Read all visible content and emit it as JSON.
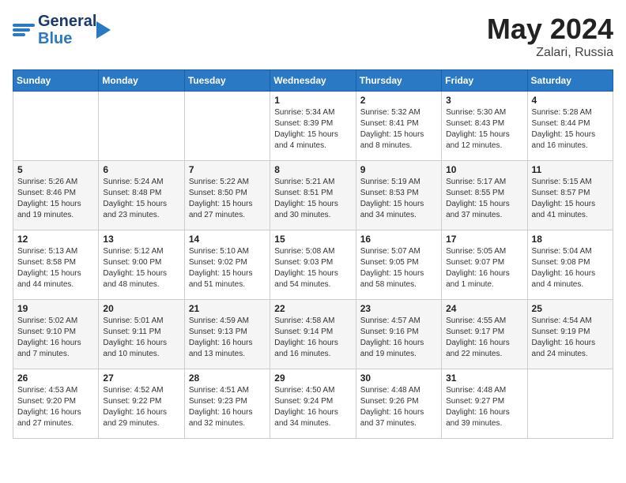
{
  "header": {
    "logo_line1": "General",
    "logo_line2": "Blue",
    "month": "May 2024",
    "location": "Zalari, Russia"
  },
  "days_of_week": [
    "Sunday",
    "Monday",
    "Tuesday",
    "Wednesday",
    "Thursday",
    "Friday",
    "Saturday"
  ],
  "weeks": [
    [
      {
        "day": "",
        "info": ""
      },
      {
        "day": "",
        "info": ""
      },
      {
        "day": "",
        "info": ""
      },
      {
        "day": "1",
        "info": "Sunrise: 5:34 AM\nSunset: 8:39 PM\nDaylight: 15 hours\nand 4 minutes."
      },
      {
        "day": "2",
        "info": "Sunrise: 5:32 AM\nSunset: 8:41 PM\nDaylight: 15 hours\nand 8 minutes."
      },
      {
        "day": "3",
        "info": "Sunrise: 5:30 AM\nSunset: 8:43 PM\nDaylight: 15 hours\nand 12 minutes."
      },
      {
        "day": "4",
        "info": "Sunrise: 5:28 AM\nSunset: 8:44 PM\nDaylight: 15 hours\nand 16 minutes."
      }
    ],
    [
      {
        "day": "5",
        "info": "Sunrise: 5:26 AM\nSunset: 8:46 PM\nDaylight: 15 hours\nand 19 minutes."
      },
      {
        "day": "6",
        "info": "Sunrise: 5:24 AM\nSunset: 8:48 PM\nDaylight: 15 hours\nand 23 minutes."
      },
      {
        "day": "7",
        "info": "Sunrise: 5:22 AM\nSunset: 8:50 PM\nDaylight: 15 hours\nand 27 minutes."
      },
      {
        "day": "8",
        "info": "Sunrise: 5:21 AM\nSunset: 8:51 PM\nDaylight: 15 hours\nand 30 minutes."
      },
      {
        "day": "9",
        "info": "Sunrise: 5:19 AM\nSunset: 8:53 PM\nDaylight: 15 hours\nand 34 minutes."
      },
      {
        "day": "10",
        "info": "Sunrise: 5:17 AM\nSunset: 8:55 PM\nDaylight: 15 hours\nand 37 minutes."
      },
      {
        "day": "11",
        "info": "Sunrise: 5:15 AM\nSunset: 8:57 PM\nDaylight: 15 hours\nand 41 minutes."
      }
    ],
    [
      {
        "day": "12",
        "info": "Sunrise: 5:13 AM\nSunset: 8:58 PM\nDaylight: 15 hours\nand 44 minutes."
      },
      {
        "day": "13",
        "info": "Sunrise: 5:12 AM\nSunset: 9:00 PM\nDaylight: 15 hours\nand 48 minutes."
      },
      {
        "day": "14",
        "info": "Sunrise: 5:10 AM\nSunset: 9:02 PM\nDaylight: 15 hours\nand 51 minutes."
      },
      {
        "day": "15",
        "info": "Sunrise: 5:08 AM\nSunset: 9:03 PM\nDaylight: 15 hours\nand 54 minutes."
      },
      {
        "day": "16",
        "info": "Sunrise: 5:07 AM\nSunset: 9:05 PM\nDaylight: 15 hours\nand 58 minutes."
      },
      {
        "day": "17",
        "info": "Sunrise: 5:05 AM\nSunset: 9:07 PM\nDaylight: 16 hours\nand 1 minute."
      },
      {
        "day": "18",
        "info": "Sunrise: 5:04 AM\nSunset: 9:08 PM\nDaylight: 16 hours\nand 4 minutes."
      }
    ],
    [
      {
        "day": "19",
        "info": "Sunrise: 5:02 AM\nSunset: 9:10 PM\nDaylight: 16 hours\nand 7 minutes."
      },
      {
        "day": "20",
        "info": "Sunrise: 5:01 AM\nSunset: 9:11 PM\nDaylight: 16 hours\nand 10 minutes."
      },
      {
        "day": "21",
        "info": "Sunrise: 4:59 AM\nSunset: 9:13 PM\nDaylight: 16 hours\nand 13 minutes."
      },
      {
        "day": "22",
        "info": "Sunrise: 4:58 AM\nSunset: 9:14 PM\nDaylight: 16 hours\nand 16 minutes."
      },
      {
        "day": "23",
        "info": "Sunrise: 4:57 AM\nSunset: 9:16 PM\nDaylight: 16 hours\nand 19 minutes."
      },
      {
        "day": "24",
        "info": "Sunrise: 4:55 AM\nSunset: 9:17 PM\nDaylight: 16 hours\nand 22 minutes."
      },
      {
        "day": "25",
        "info": "Sunrise: 4:54 AM\nSunset: 9:19 PM\nDaylight: 16 hours\nand 24 minutes."
      }
    ],
    [
      {
        "day": "26",
        "info": "Sunrise: 4:53 AM\nSunset: 9:20 PM\nDaylight: 16 hours\nand 27 minutes."
      },
      {
        "day": "27",
        "info": "Sunrise: 4:52 AM\nSunset: 9:22 PM\nDaylight: 16 hours\nand 29 minutes."
      },
      {
        "day": "28",
        "info": "Sunrise: 4:51 AM\nSunset: 9:23 PM\nDaylight: 16 hours\nand 32 minutes."
      },
      {
        "day": "29",
        "info": "Sunrise: 4:50 AM\nSunset: 9:24 PM\nDaylight: 16 hours\nand 34 minutes."
      },
      {
        "day": "30",
        "info": "Sunrise: 4:48 AM\nSunset: 9:26 PM\nDaylight: 16 hours\nand 37 minutes."
      },
      {
        "day": "31",
        "info": "Sunrise: 4:48 AM\nSunset: 9:27 PM\nDaylight: 16 hours\nand 39 minutes."
      },
      {
        "day": "",
        "info": ""
      }
    ]
  ]
}
